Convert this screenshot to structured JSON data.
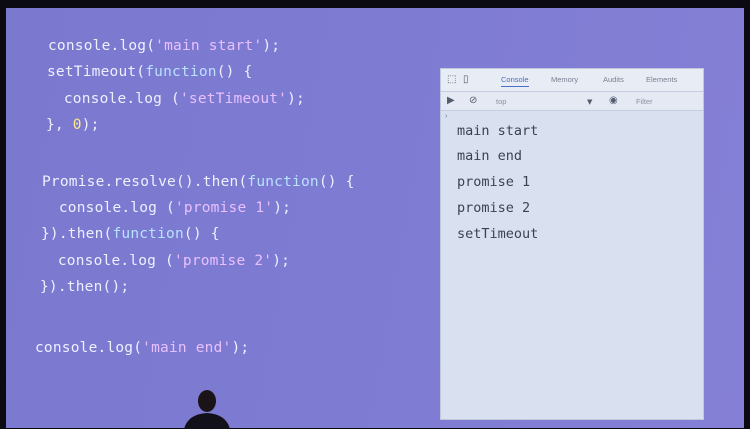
{
  "code": {
    "lines": [
      {
        "parts": [
          {
            "t": "console.log(",
            "c": ""
          },
          {
            "t": "'main start'",
            "c": "str"
          },
          {
            "t": ");",
            "c": ""
          }
        ]
      },
      {
        "parts": [
          {
            "t": "setTimeout(",
            "c": ""
          },
          {
            "t": "function",
            "c": "fn"
          },
          {
            "t": "() {",
            "c": ""
          }
        ]
      },
      {
        "parts": [
          {
            "t": "  console.log (",
            "c": ""
          },
          {
            "t": "'setTimeout'",
            "c": "str"
          },
          {
            "t": ");",
            "c": ""
          }
        ]
      },
      {
        "parts": [
          {
            "t": "}, ",
            "c": ""
          },
          {
            "t": "0",
            "c": "num"
          },
          {
            "t": ");",
            "c": ""
          }
        ]
      },
      {
        "parts": [
          {
            "t": "Promise.resolve().then(",
            "c": ""
          },
          {
            "t": "function",
            "c": "fn"
          },
          {
            "t": "() {",
            "c": ""
          }
        ]
      },
      {
        "parts": [
          {
            "t": "  console.log (",
            "c": ""
          },
          {
            "t": "'promise 1'",
            "c": "str"
          },
          {
            "t": ");",
            "c": ""
          }
        ]
      },
      {
        "parts": [
          {
            "t": "}).then(",
            "c": ""
          },
          {
            "t": "function",
            "c": "fn"
          },
          {
            "t": "() {",
            "c": ""
          }
        ]
      },
      {
        "parts": [
          {
            "t": "  console.log (",
            "c": ""
          },
          {
            "t": "'promise 2'",
            "c": "str"
          },
          {
            "t": ");",
            "c": ""
          }
        ]
      },
      {
        "parts": [
          {
            "t": "}).then();",
            "c": ""
          }
        ]
      },
      {
        "parts": [
          {
            "t": "console.log(",
            "c": ""
          },
          {
            "t": "'main end'",
            "c": "str"
          },
          {
            "t": ");",
            "c": ""
          }
        ]
      }
    ]
  },
  "devtools": {
    "tabs": [
      "Console",
      "Memory",
      "Audits",
      "Elements"
    ],
    "active_tab": "Console",
    "context": "top",
    "filter_placeholder": "Filter",
    "prompt_symbol": "›",
    "icons": {
      "inspect": "inspect-icon",
      "device": "device-toggle-icon",
      "clear": "clear-console-icon",
      "block": "block-icon",
      "dropdown": "dropdown-caret-icon",
      "eye": "eye-icon"
    }
  },
  "console": {
    "output": [
      "main start",
      "main end",
      "promise 1",
      "promise 2",
      "setTimeout"
    ]
  },
  "colors": {
    "slide_background": "#7d7bd2",
    "code_text": "#eef0ff",
    "string": "#e9c0ff",
    "keyword": "#b9e2ff",
    "number": "#ffe88a",
    "devtools_bg": "#d9e1f1",
    "console_text": "#3d4253",
    "active_tab": "#4a6fc4"
  }
}
